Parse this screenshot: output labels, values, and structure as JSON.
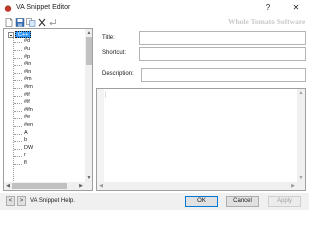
{
  "window": {
    "title": "VA Snippet Editor",
    "help_glyph": "?",
    "close_glyph": "✕"
  },
  "toolbar": {
    "watermark": "Whole Tomato Software"
  },
  "tree": {
    "root_label": "C++",
    "items": [
      "#d",
      "#u",
      "#p",
      "#in",
      "#in",
      "#m",
      "#im",
      "#if",
      "#if",
      "#ifn",
      "#e",
      "#en",
      "A",
      "b",
      "DW",
      "r",
      "fl"
    ]
  },
  "form": {
    "title_label": "Title:",
    "title_value": "",
    "shortcut_label": "Shortcut:",
    "shortcut_value": "",
    "description_label": "Description:",
    "description_value": ""
  },
  "editor": {
    "content": ""
  },
  "footer": {
    "prev_label": "<",
    "next_label": ">",
    "help_label": "VA Snippet Help.",
    "ok_label": "OK",
    "cancel_label": "Cancel",
    "apply_label": "Apply"
  },
  "colors": {
    "selection": "#3399ff",
    "ok_border": "#0078d7",
    "watermark": "#c9c9c9",
    "app_icon": "#c0392b"
  }
}
